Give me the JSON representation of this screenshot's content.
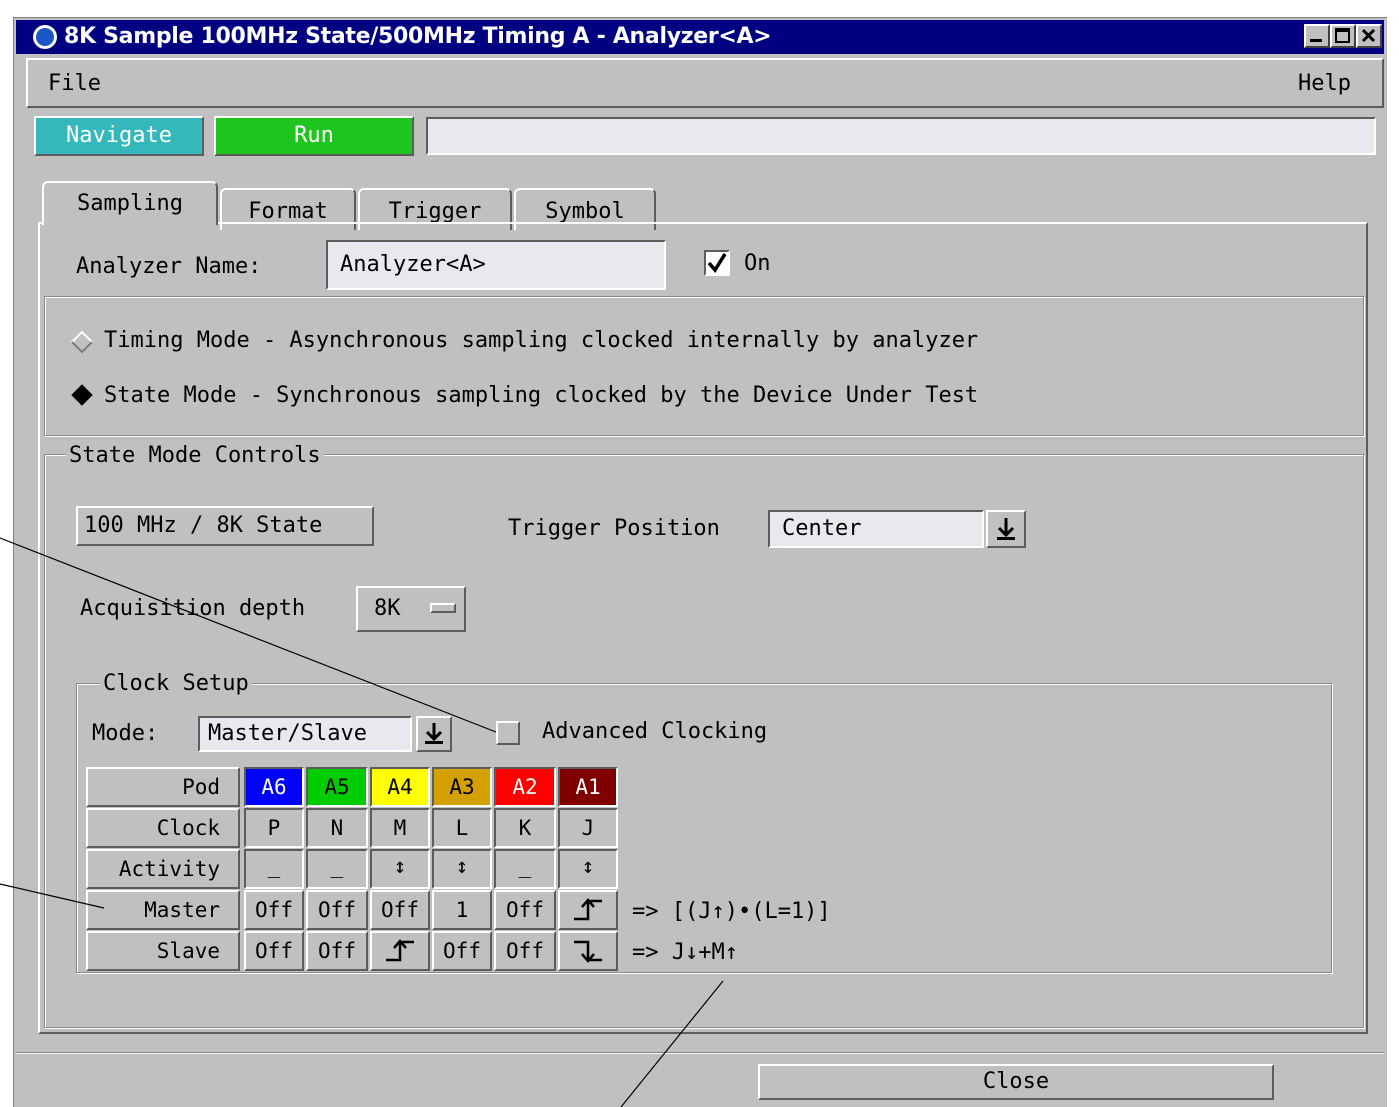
{
  "window": {
    "title": "8K Sample 100MHz State/500MHz Timing A - Analyzer<A>",
    "controls": [
      "_",
      "□",
      "×"
    ]
  },
  "menu": {
    "file": "File",
    "help": "Help"
  },
  "toolbar": {
    "navigate": "Navigate",
    "run": "Run",
    "status": ""
  },
  "tabs": [
    "Sampling",
    "Format",
    "Trigger",
    "Symbol"
  ],
  "analyzer": {
    "name_label": "Analyzer Name:",
    "name_value": "Analyzer<A>",
    "on_label": "On",
    "on_checked": true
  },
  "modes": {
    "timing": "Timing Mode  - Asynchronous sampling clocked internally by analyzer",
    "state": "State Mode   - Synchronous sampling clocked by the Device Under Test",
    "selected": "state"
  },
  "state_controls": {
    "title": "State Mode Controls",
    "speed": "100 MHz / 8K State",
    "trigger_position_label": "Trigger Position",
    "trigger_position_value": "Center",
    "acq_depth_label": "Acquisition depth",
    "acq_depth_value": "8K"
  },
  "clock_setup": {
    "title": "Clock Setup",
    "mode_label": "Mode:",
    "mode_value": "Master/Slave",
    "advanced_label": "Advanced Clocking",
    "advanced_checked": false,
    "row_labels": [
      "Pod",
      "Clock",
      "Activity",
      "Master",
      "Slave"
    ],
    "pods": [
      {
        "name": "A6",
        "color": "#0000ff",
        "text_color": "#ffffff"
      },
      {
        "name": "A5",
        "color": "#00cc00",
        "text_color": "#000000"
      },
      {
        "name": "A4",
        "color": "#ffff00",
        "text_color": "#000000"
      },
      {
        "name": "A3",
        "color": "#d4a000",
        "text_color": "#000000"
      },
      {
        "name": "A2",
        "color": "#ff0000",
        "text_color": "#ffffff"
      },
      {
        "name": "A1",
        "color": "#800000",
        "text_color": "#ffffff"
      }
    ],
    "clocks": [
      "P",
      "N",
      "M",
      "L",
      "K",
      "J"
    ],
    "activity": [
      "_",
      "_",
      "↕",
      "↕",
      "_",
      "↕"
    ],
    "master": [
      "Off",
      "Off",
      "Off",
      "1",
      "Off",
      "rising-edge-icon"
    ],
    "slave": [
      "Off",
      "Off",
      "rising-edge-icon",
      "Off",
      "Off",
      "falling-edge-icon"
    ],
    "master_expr": "=>  [(J↑)•(L=1)]",
    "slave_expr": "=>  J↓+M↑"
  },
  "close_button": "Close"
}
